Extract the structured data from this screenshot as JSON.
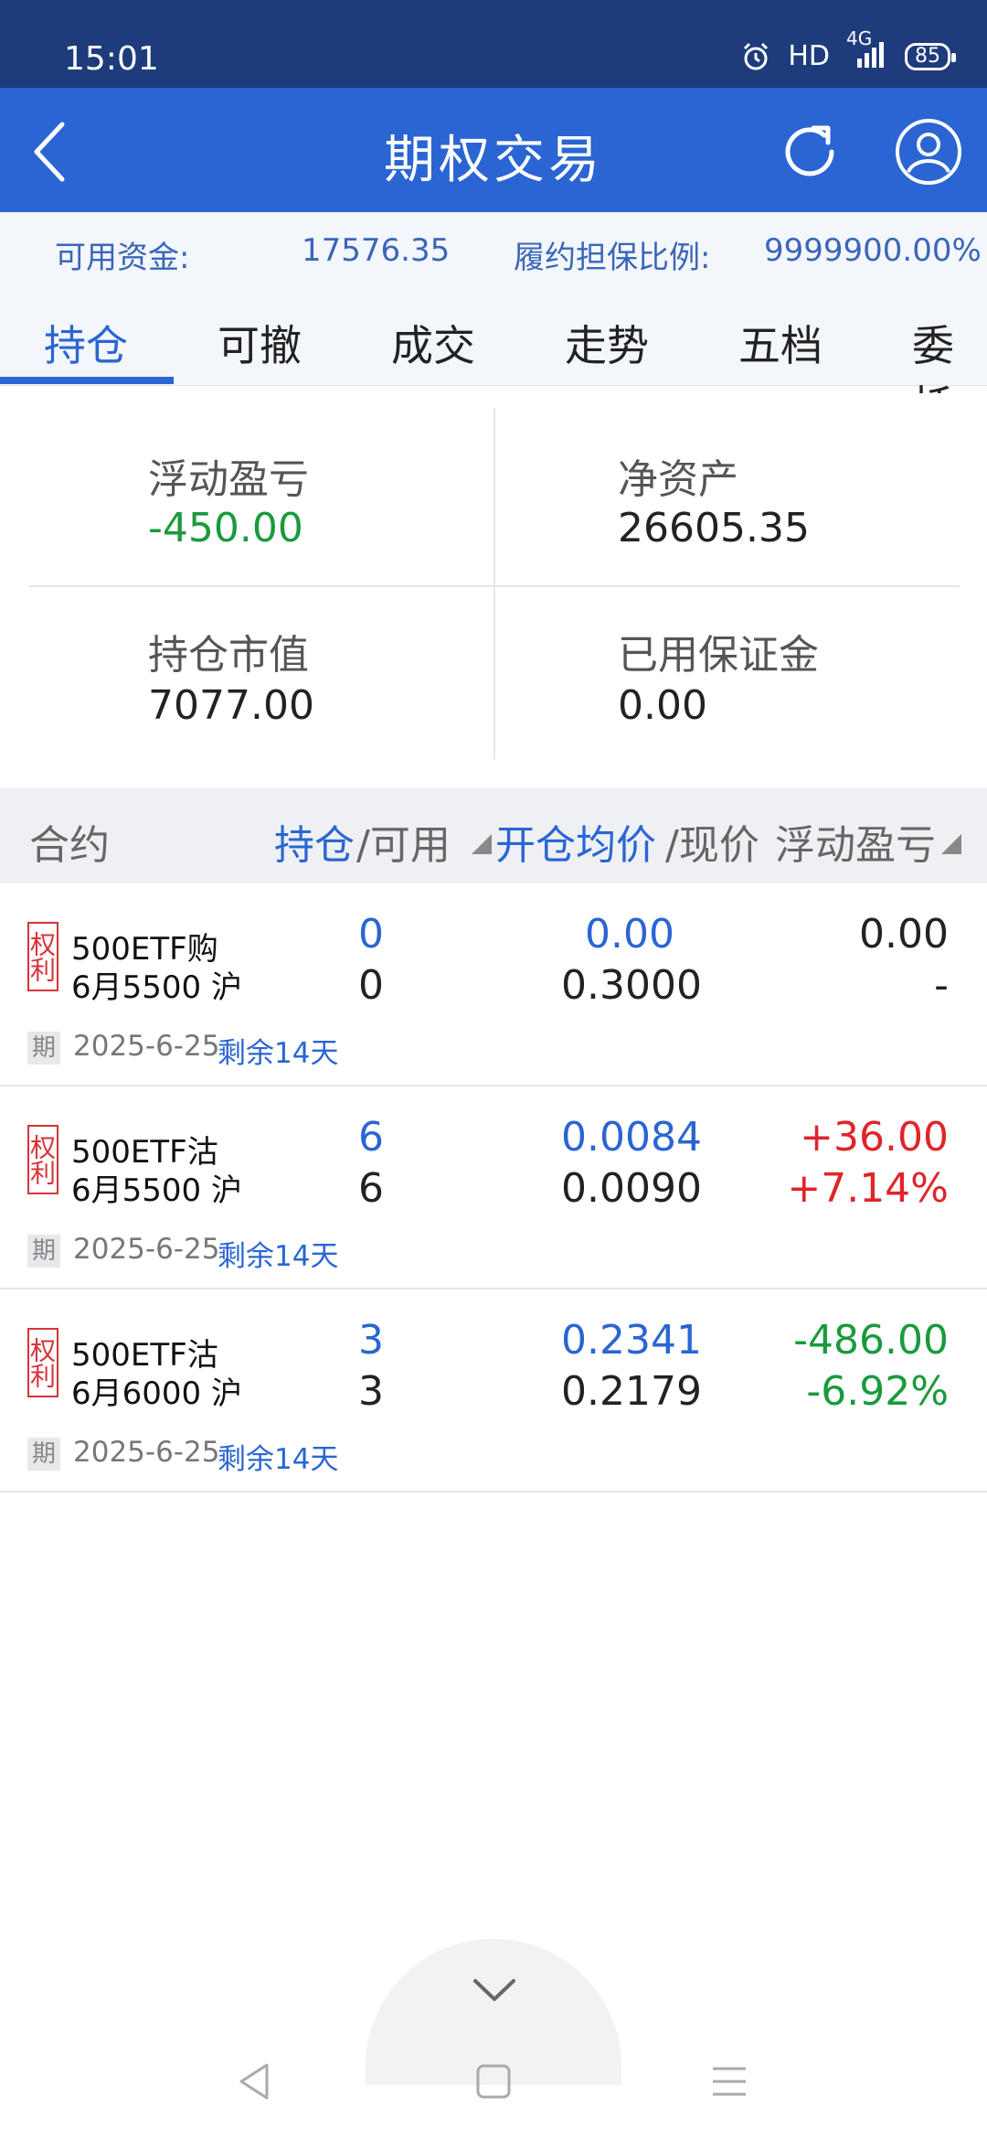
{
  "status": {
    "time": "15:01",
    "hd": "HD",
    "net": "4G",
    "battery": "85"
  },
  "header": {
    "title": "期权交易"
  },
  "funds": {
    "available_label": "可用资金:",
    "available_value": "17576.35",
    "ratio_label": "履约担保比例:",
    "ratio_value": "9999900.00%"
  },
  "tabs": [
    "持仓",
    "可撤",
    "成交",
    "走势",
    "五档",
    "委托"
  ],
  "summary": {
    "float_pl_label": "浮动盈亏",
    "float_pl_value": "-450.00",
    "net_assets_label": "净资产",
    "net_assets_value": "26605.35",
    "market_value_label": "持仓市值",
    "market_value_value": "7077.00",
    "margin_label": "已用保证金",
    "margin_value": "0.00"
  },
  "list_header": {
    "contract": "合约",
    "position": "持仓",
    "available": "/可用",
    "open_price": "开仓均价",
    "current_price": "/现价",
    "float_pl": "浮动盈亏"
  },
  "rows": [
    {
      "stamp": "权利",
      "name": "500ETF购",
      "month": "6月5500 沪",
      "position": "0",
      "available": "0",
      "avg_price": "0.00",
      "cur_price": "0.3000",
      "pl": "0.00",
      "pl_pct": "-",
      "tag": "期",
      "date": "2025-6-25",
      "remain": "剩余14天"
    },
    {
      "stamp": "权利",
      "name": "500ETF沽",
      "month": "6月5500 沪",
      "position": "6",
      "available": "6",
      "avg_price": "0.0084",
      "cur_price": "0.0090",
      "pl": "+36.00",
      "pl_pct": "+7.14%",
      "tag": "期",
      "date": "2025-6-25",
      "remain": "剩余14天"
    },
    {
      "stamp": "权利",
      "name": "500ETF沽",
      "month": "6月6000 沪",
      "position": "3",
      "available": "3",
      "avg_price": "0.2341",
      "cur_price": "0.2179",
      "pl": "-486.00",
      "pl_pct": "-6.92%",
      "tag": "期",
      "date": "2025-6-25",
      "remain": "剩余14天"
    }
  ],
  "colors": {
    "header": "#2a65d3",
    "statusbar": "#1e3c7c",
    "gain": "#e0242a",
    "loss": "#1a9a3c"
  },
  "icons": [
    "back-icon",
    "refresh-icon",
    "profile-icon",
    "chevron-down-icon",
    "nav-back-icon",
    "nav-home-icon",
    "nav-menu-icon"
  ]
}
